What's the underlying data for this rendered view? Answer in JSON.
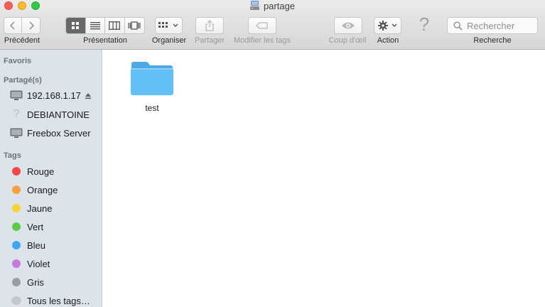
{
  "window": {
    "title": "partage"
  },
  "toolbar": {
    "back_label": "Précédent",
    "view_label": "Présentation",
    "arrange_label": "Organiser",
    "share_label": "Partager",
    "tags_label": "Modifier les tags",
    "quicklook_label": "Coup d'œil",
    "action_label": "Action",
    "search_label": "Recherche",
    "search_placeholder": "Rechercher",
    "active_view": "icon"
  },
  "sidebar": {
    "favorites_header": "Favoris",
    "shared_header": "Partagé(s)",
    "shared_items": [
      {
        "label": "192.168.1.17",
        "icon": "monitor-icon"
      },
      {
        "label": "DEBIANTOINE",
        "icon": "question-icon"
      },
      {
        "label": "Freebox Server",
        "icon": "monitor-icon"
      }
    ],
    "tags_header": "Tags",
    "tags": [
      {
        "label": "Rouge",
        "color": "#f5474c"
      },
      {
        "label": "Orange",
        "color": "#f7a23a"
      },
      {
        "label": "Jaune",
        "color": "#f7d339"
      },
      {
        "label": "Vert",
        "color": "#5ccb45"
      },
      {
        "label": "Bleu",
        "color": "#3ea6f5"
      },
      {
        "label": "Violet",
        "color": "#c779dd"
      },
      {
        "label": "Gris",
        "color": "#9c9c9e"
      },
      {
        "label": "Tous les tags…",
        "color": "#c4c7cc"
      }
    ]
  },
  "main": {
    "files": [
      {
        "name": "test",
        "icon": "folder-icon",
        "color": "#5fbff5"
      }
    ]
  }
}
